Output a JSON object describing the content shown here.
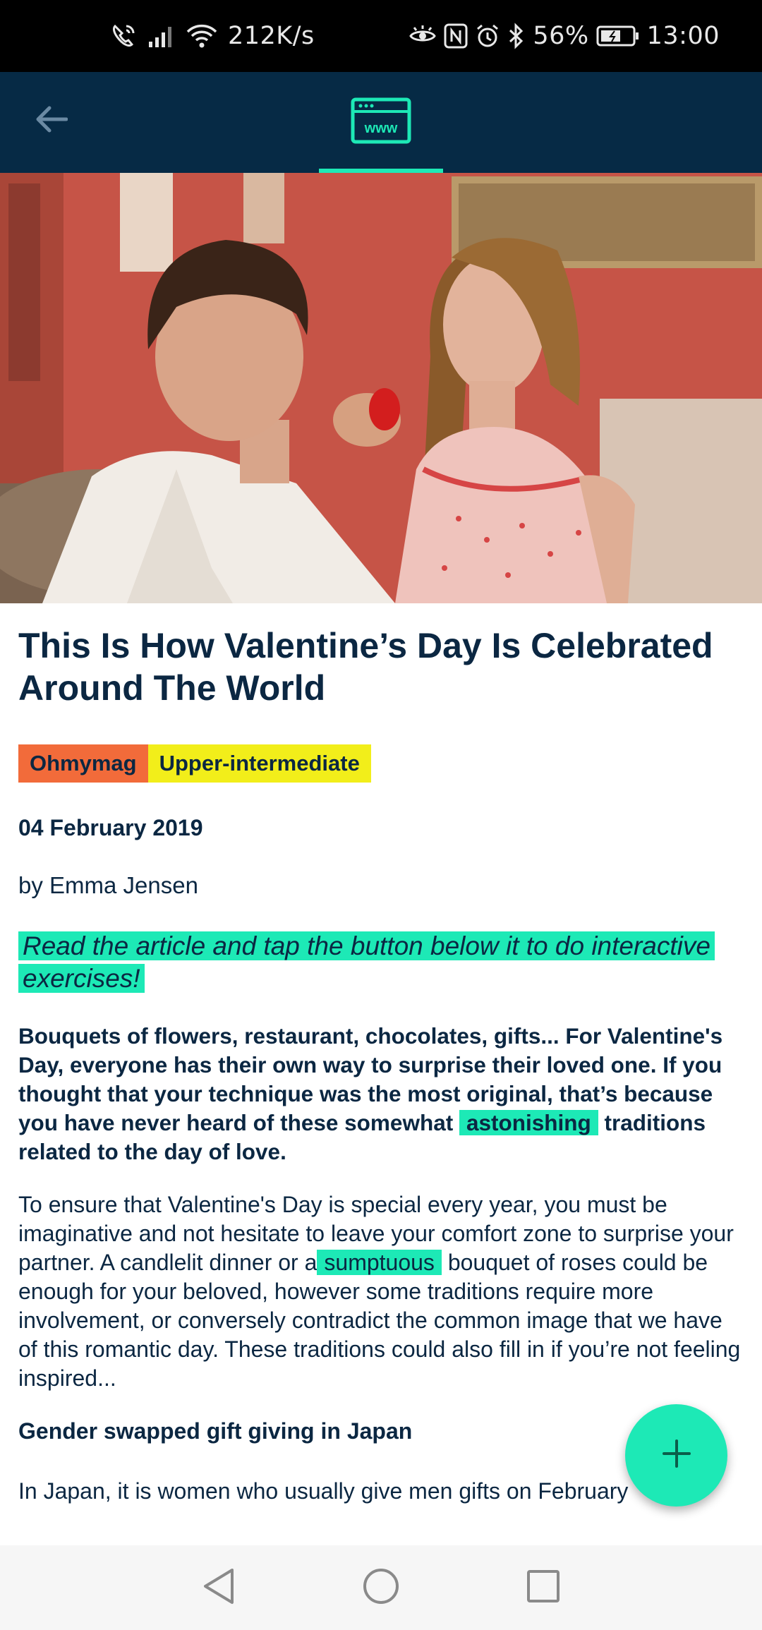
{
  "status_bar": {
    "network_speed": "212K/s",
    "battery_percent": "56%",
    "time": "13:00"
  },
  "app_bar": {
    "back_icon": "arrow-left-icon",
    "tab_icon": "www-browser-icon",
    "tab_icon_label": "www"
  },
  "article": {
    "title": "This Is How Valentine’s Day Is Celebrated Around The World",
    "source_tag": "Ohmymag",
    "level_tag": "Upper-intermediate",
    "date": "04 February 2019",
    "author": "by Emma Jensen",
    "prompt": "Read the article and tap the button below it to do interactive exercises!",
    "lead_before": "Bouquets of flowers, restaurant, chocolates, gifts... For Valentine's Day, everyone has their own way to surprise their loved one. If you thought that your technique was the most original, that’s because you have never heard of these somewhat",
    "lead_highlight": "astonishing",
    "lead_after": "traditions related to the day of love.",
    "para1_before": "To ensure that Valentine's Day is special every year, you must be imaginative and not hesitate to leave your comfort zone to surprise your partner. A candlelit dinner or a",
    "para1_highlight": "sumptuous",
    "para1_after": "bouquet of roses could be enough for your beloved, however some traditions require more involvement, or conversely contradict the common image that we have of this romantic day. These traditions could also fill in if you’re not feeling inspired...",
    "subheading": "Gender swapped gift giving in Japan",
    "para2": "In Japan, it is women who usually give men gifts on February"
  },
  "fab": {
    "icon": "plus-icon"
  },
  "colors": {
    "app_bar": "#062a45",
    "accent": "#1de9b6",
    "source_tag": "#f26b3a",
    "level_tag": "#f2ee1a",
    "text": "#0b2742"
  }
}
